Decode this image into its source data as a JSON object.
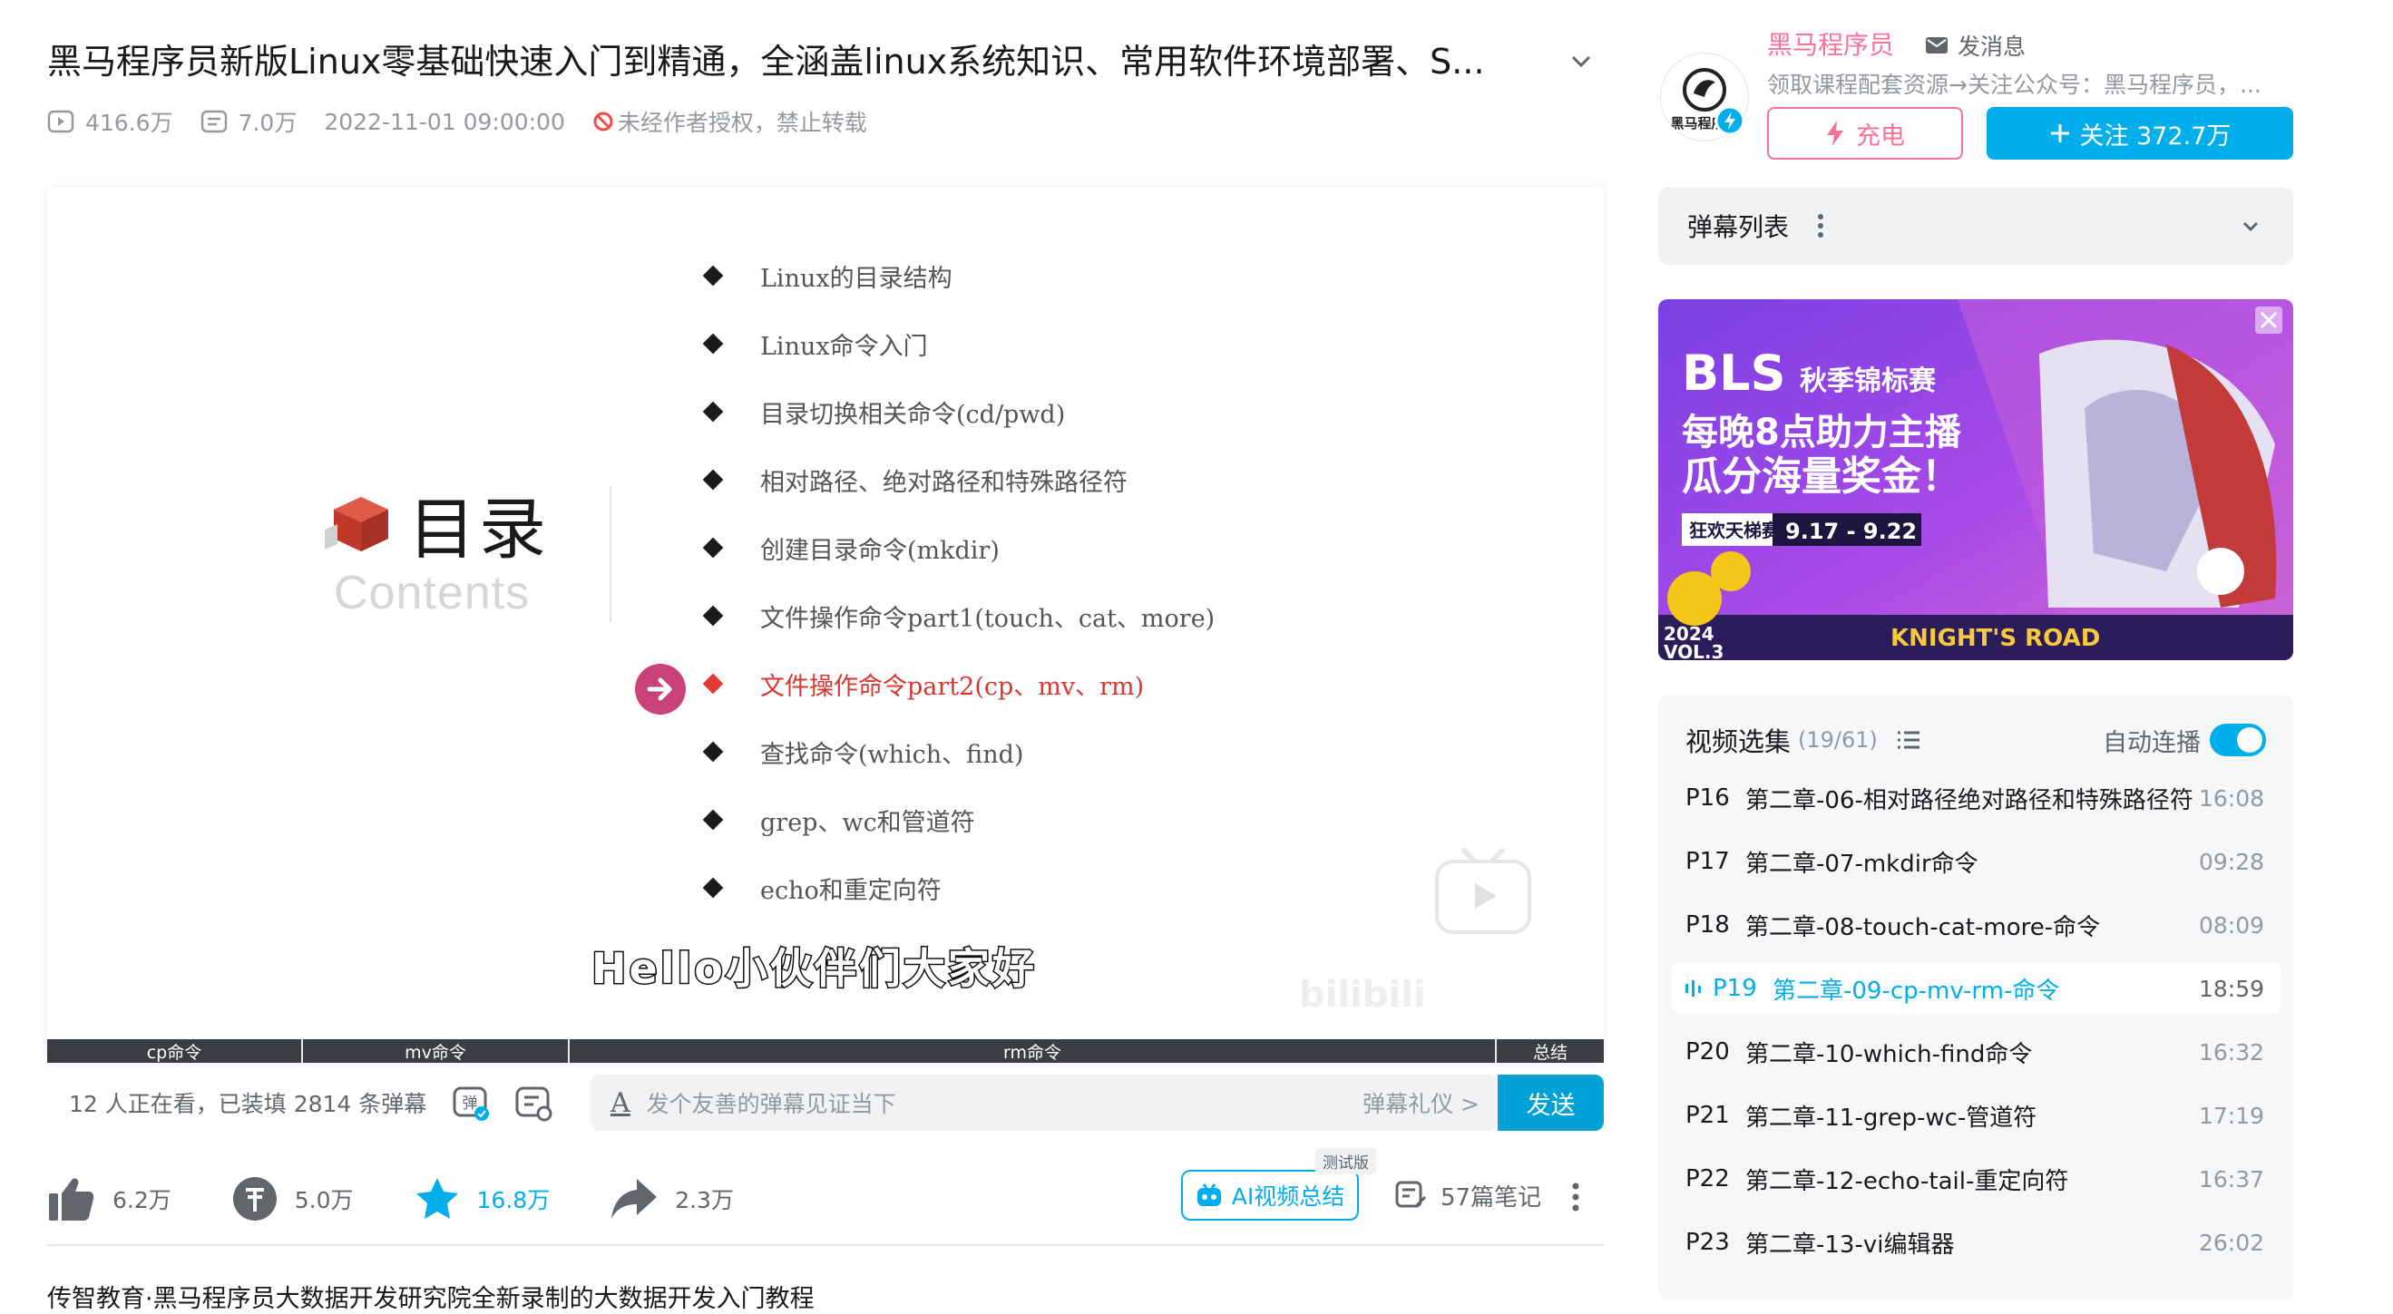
{
  "video": {
    "title": "黑马程序员新版Linux零基础快速入门到精通，全涵盖linux系统知识、常用软件环境部署、S...",
    "views": "416.6万",
    "danmaku_count": "7.0万",
    "date": "2022-11-01 09:00:00",
    "copyright": "未经作者授权，禁止转载"
  },
  "slide": {
    "title": "目录",
    "subtitle": "Contents",
    "items": [
      "Linux的目录结构",
      "Linux命令入门",
      "目录切换相关命令(cd/pwd)",
      "相对路径、绝对路径和特殊路径符",
      "创建目录命令(mkdir)",
      "文件操作命令part1(touch、cat、more)",
      "文件操作命令part2(cp、mv、rm)",
      "查找命令(which、find)",
      "grep、wc和管道符",
      "echo和重定向符"
    ],
    "active_index": 6,
    "caption": "Hello小伙伴们大家好",
    "watermark": "bilibili"
  },
  "progress": {
    "chapters": [
      {
        "label": "cp命令"
      },
      {
        "label": "mv命令"
      },
      {
        "label": "rm命令"
      },
      {
        "label": "总结"
      }
    ]
  },
  "danmaku_bar": {
    "info": "12 人正在看，已装填 2814 条弹幕",
    "placeholder": "发个友善的弹幕见证当下",
    "etiquette": "弹幕礼仪 >",
    "send": "发送"
  },
  "actions": {
    "like": "6.2万",
    "coin": "5.0万",
    "favorite": "16.8万",
    "share": "2.3万",
    "ai_summary": "AI视频总结",
    "ai_tag": "测试版",
    "notes": "57篇笔记"
  },
  "description": "传智教育·黑马程序员大数据开发研究院全新录制的大数据开发入门教程",
  "uploader": {
    "name": "黑马程序员",
    "message": "发消息",
    "desc": "领取课程配套资源→关注公众号：黑马程序员，...",
    "avatar_text": "黑马程序员",
    "charge": "充电",
    "follow": "关注 372.7万"
  },
  "danmaku_list": {
    "title": "弹幕列表"
  },
  "ad": {
    "brand": "BLS",
    "event": "秋季锦标赛",
    "line1": "每晚8点助力主播",
    "line2": "瓜分海量奖金！",
    "tag": "狂欢天梯赛",
    "dates": "9.17 - 9.22",
    "year": "2024",
    "vol": "VOL.3",
    "road": "KNIGHT'S ROAD"
  },
  "episodes": {
    "title": "视频选集",
    "count": "(19/61)",
    "autoplay": "自动连播",
    "list": [
      {
        "p": "P16",
        "name": "第二章-06-相对路径绝对路径和特殊路径符",
        "dur": "16:08"
      },
      {
        "p": "P17",
        "name": "第二章-07-mkdir命令",
        "dur": "09:28"
      },
      {
        "p": "P18",
        "name": "第二章-08-touch-cat-more-命令",
        "dur": "08:09"
      },
      {
        "p": "P19",
        "name": "第二章-09-cp-mv-rm-命令",
        "dur": "18:59"
      },
      {
        "p": "P20",
        "name": "第二章-10-which-find命令",
        "dur": "16:32"
      },
      {
        "p": "P21",
        "name": "第二章-11-grep-wc-管道符",
        "dur": "17:19"
      },
      {
        "p": "P22",
        "name": "第二章-12-echo-tail-重定向符",
        "dur": "16:37"
      },
      {
        "p": "P23",
        "name": "第二章-13-vi编辑器",
        "dur": "26:02"
      }
    ]
  },
  "colors": {
    "accent": "#00aeec",
    "pink": "#fb7299",
    "active_item": "#d7372f"
  }
}
